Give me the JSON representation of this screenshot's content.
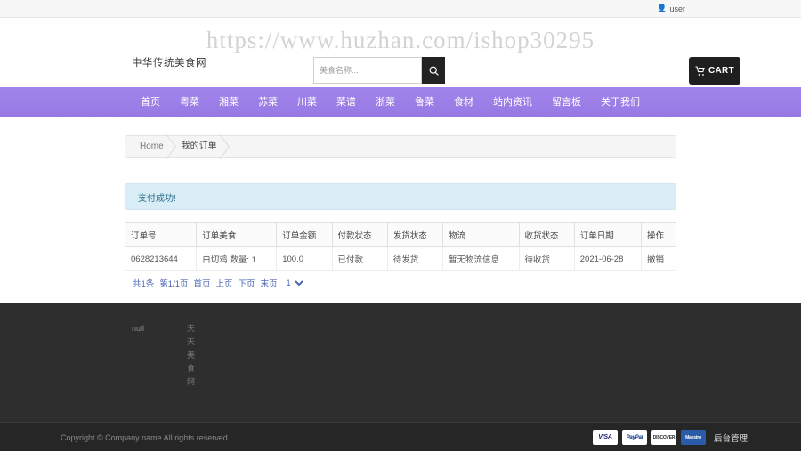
{
  "topbar": {
    "user_label": "user",
    "user_icon": "user-icon"
  },
  "header": {
    "site_title": "中华传统美食网",
    "search_placeholder": "美食名称...",
    "search_value": "",
    "search_icon": "search-icon",
    "cart_label": "CART",
    "cart_icon": "cart-icon",
    "watermark": "https://www.huzhan.com/ishop30295"
  },
  "nav": {
    "items": [
      {
        "label": "首页"
      },
      {
        "label": "粤菜"
      },
      {
        "label": "湘菜"
      },
      {
        "label": "苏菜"
      },
      {
        "label": "川菜"
      },
      {
        "label": "菜谱"
      },
      {
        "label": "浙菜"
      },
      {
        "label": "鲁菜"
      },
      {
        "label": "食材"
      },
      {
        "label": "站内资讯"
      },
      {
        "label": "留言板"
      },
      {
        "label": "关于我们"
      }
    ]
  },
  "breadcrumb": {
    "items": [
      {
        "label": "Home"
      },
      {
        "label": "我的订单"
      }
    ]
  },
  "alert": {
    "message": "支付成功!"
  },
  "orders_table": {
    "headers": [
      "订单号",
      "订单美食",
      "订单金额",
      "付款状态",
      "发货状态",
      "物流",
      "收货状态",
      "订单日期",
      "操作"
    ],
    "rows": [
      {
        "order_no": "0628213644",
        "food": "白切鸡 数量: 1",
        "amount": "100.0",
        "pay_status": "已付款",
        "ship_status": "待发货",
        "logistics": "暂无物流信息",
        "receive_status": "待收货",
        "order_date": "2021-06-28",
        "operation": "撤销"
      }
    ]
  },
  "pagination": {
    "total_text": "共1条",
    "page_text": "第1/1页",
    "first": "首页",
    "prev": "上页",
    "next": "下页",
    "last": "末页",
    "selected_page": "1",
    "page_options": [
      "1"
    ]
  },
  "footer": {
    "col_a": "null",
    "vertical_text": "天天美食网"
  },
  "bottombar": {
    "copyright": "Copyright © Company name All rights reserved.",
    "payments": [
      {
        "name": "VISA",
        "class": "pay-visa"
      },
      {
        "name": "PayPal",
        "class": "pay-paypal"
      },
      {
        "name": "DISCOVER",
        "class": "pay-discover"
      },
      {
        "name": "Maestro",
        "class": "pay-maestro"
      }
    ],
    "admin_label": "后台管理"
  },
  "colors": {
    "nav_purple": "#9b7fe8",
    "alert_blue": "#d9edf7",
    "alert_text": "#31708f",
    "footer_dark": "#2e2e2e",
    "bottom_dark": "#262626",
    "link_blue": "#4f6ab5"
  }
}
